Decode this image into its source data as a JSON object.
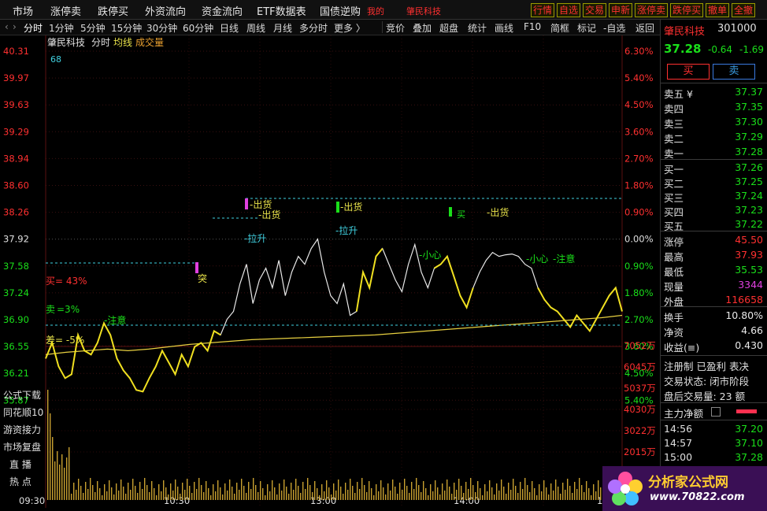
{
  "menu": {
    "items": [
      "市场",
      "涨停卖",
      "跌停买",
      "外资流向",
      "资金流向",
      "ETF数据表",
      "国债逆购"
    ],
    "user_label": "我的",
    "stock_name": "肇民科技",
    "right_buttons": [
      "行情",
      "自选",
      "交易",
      "申新",
      "涨停卖",
      "跌停买",
      "撤单",
      "全撤"
    ]
  },
  "periods": {
    "items": [
      "分时",
      "1分钟",
      "5分钟",
      "15分钟",
      "30分钟",
      "60分钟",
      "日线",
      "周线",
      "月线",
      "多分时",
      "更多 〉"
    ],
    "tools": [
      "竞价",
      "叠加",
      "超盘",
      "统计",
      "画线",
      "F10",
      "简框",
      "标记",
      "-自选",
      "返回"
    ]
  },
  "chart": {
    "header_name": "肇民科技",
    "header_mode": "分时",
    "header_avg": "均线",
    "header_vol": "成交量",
    "corner_value": "68",
    "price_labels": [
      "40.31",
      "39.97",
      "39.63",
      "39.29",
      "38.94",
      "38.60",
      "38.26",
      "37.92",
      "37.58",
      "37.24",
      "36.90",
      "36.55",
      "36.21",
      "35.87"
    ],
    "pct_labels": [
      "6.30%",
      "5.40%",
      "4.50%",
      "3.60%",
      "2.70%",
      "1.80%",
      "0.90%",
      "0.00%",
      "0.90%",
      "1.80%",
      "2.70%",
      "3.60%",
      "4.50%",
      "5.40%"
    ],
    "vol_labels": [
      "7052万",
      "6045万",
      "5037万",
      "4030万",
      "3022万",
      "2015万"
    ],
    "time_labels": [
      "09:30",
      "10:30",
      "13:00",
      "14:00",
      "1"
    ],
    "diff_label": "差= -5%",
    "annotations": {
      "tu": "突",
      "chuhuo1": "-出货",
      "chuhuo2": "-出货",
      "chuhuo3": "-出货",
      "chuhuo4": "-出货",
      "lasheng1": "-拉升",
      "lasheng2": "-拉升",
      "xiaoxin1": "-小心",
      "xiaoxin2": "-小心",
      "zhuyi": "-注意",
      "zhuyi2": "-注意",
      "mai": "买",
      "mai2": "买",
      "mai_pct": "= 43%",
      "low_pct": "=3%",
      "left_label": "卖"
    },
    "side_menu": [
      "公式下载",
      "同花顺10",
      "游资接力",
      "市场复盘",
      "直 播",
      "热 点"
    ]
  },
  "chart_data": {
    "type": "line",
    "title": "",
    "ylim": [
      35.87,
      40.31
    ],
    "ref_price": 37.92,
    "price": [
      36.4,
      36.6,
      36.3,
      36.15,
      36.2,
      36.7,
      36.5,
      36.45,
      36.6,
      36.85,
      36.7,
      36.4,
      36.25,
      36.15,
      36.0,
      35.98,
      36.15,
      36.3,
      36.5,
      36.35,
      36.2,
      36.45,
      36.3,
      36.55,
      36.6,
      36.5,
      36.75,
      36.7,
      36.9,
      37.0,
      37.35,
      37.6,
      37.1,
      37.4,
      37.55,
      37.3,
      37.65,
      37.2,
      37.5,
      37.7,
      37.6,
      37.8,
      37.92,
      37.5,
      37.2,
      37.1,
      37.35,
      36.95,
      37.0,
      37.5,
      37.3,
      37.7,
      37.8,
      37.6,
      37.4,
      37.25,
      37.6,
      37.85,
      37.5,
      37.3,
      37.55,
      37.6,
      37.7,
      37.45,
      37.2,
      37.05,
      37.3,
      37.5,
      37.65,
      37.75,
      37.7,
      37.72,
      37.73,
      37.7,
      37.6,
      37.55,
      37.3,
      37.15,
      37.05,
      37.0,
      36.9,
      36.8,
      36.95,
      36.85,
      36.75,
      36.9,
      37.05,
      37.2,
      37.3,
      37.0
    ],
    "avg": [
      36.45,
      36.48,
      36.5,
      36.52,
      36.5,
      36.52,
      36.55,
      36.58,
      36.6,
      36.62,
      36.64,
      36.65,
      36.66,
      36.67,
      36.68,
      36.69,
      36.7,
      36.72,
      36.74,
      36.76,
      36.78,
      36.8,
      36.82,
      36.84,
      36.86,
      36.88,
      36.9,
      36.92,
      36.95
    ]
  },
  "right_panel": {
    "name": "肇民科技",
    "code": "301000",
    "price": "37.28",
    "change": "-0.64",
    "pct": "-1.69",
    "buy_btn": "买",
    "sell_btn": "卖",
    "asks": [
      [
        "卖五 ¥",
        "37.37"
      ],
      [
        "卖四",
        "37.35"
      ],
      [
        "卖三",
        "37.30"
      ],
      [
        "卖二",
        "37.29"
      ],
      [
        "卖一",
        "37.28"
      ]
    ],
    "bids": [
      [
        "买一",
        "37.26"
      ],
      [
        "买二",
        "37.25"
      ],
      [
        "买三",
        "37.24"
      ],
      [
        "买四",
        "37.23"
      ],
      [
        "买五",
        "37.22"
      ]
    ],
    "stats": [
      [
        "涨停",
        "45.50"
      ],
      [
        "最高",
        "37.93"
      ],
      [
        "最低",
        "35.53"
      ],
      [
        "现量",
        "3344"
      ],
      [
        "外盘",
        "116658"
      ]
    ],
    "stats2": [
      [
        "换手",
        "10.80%"
      ],
      [
        "净资",
        "4.66"
      ],
      [
        "收益(≡)",
        "0.430"
      ]
    ],
    "notes": [
      "注册制 已盈利 表决",
      "交易状态: 闭市阶段",
      "盘后交易量: 23  额"
    ],
    "flow_title": "主力净额",
    "ticks": [
      [
        "14:56",
        "37.20"
      ],
      [
        "14:57",
        "37.10"
      ],
      [
        "15:00",
        "37.28"
      ]
    ]
  },
  "logo": {
    "brand": "分析家公式网",
    "url": "www.70822.com"
  }
}
